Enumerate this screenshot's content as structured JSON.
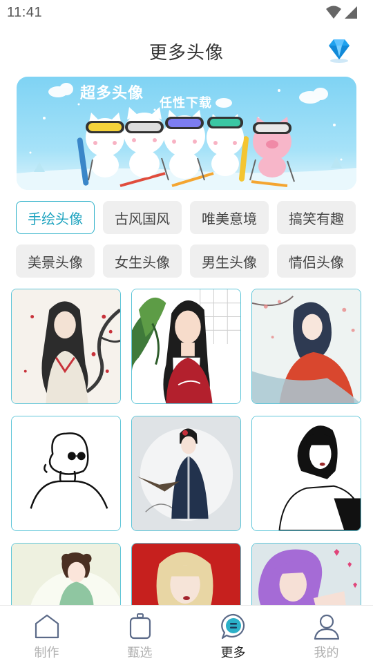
{
  "status_bar": {
    "time": "11:41"
  },
  "header": {
    "title": "更多头像"
  },
  "banner": {
    "title": "超多头像",
    "subtitle": "任性下载"
  },
  "categories": [
    {
      "label": "手绘头像",
      "active": true
    },
    {
      "label": "古风国风",
      "active": false
    },
    {
      "label": "唯美意境",
      "active": false
    },
    {
      "label": "搞笑有趣",
      "active": false
    },
    {
      "label": "美景头像",
      "active": false
    },
    {
      "label": "女生头像",
      "active": false
    },
    {
      "label": "男生头像",
      "active": false
    },
    {
      "label": "情侣头像",
      "active": false
    }
  ],
  "bottom_nav": [
    {
      "label": "制作",
      "icon": "pentagon-icon",
      "active": false
    },
    {
      "label": "甄选",
      "icon": "bag-icon",
      "active": false
    },
    {
      "label": "更多",
      "icon": "chat-bubble-icon",
      "active": true
    },
    {
      "label": "我的",
      "icon": "person-icon",
      "active": false
    }
  ],
  "colors": {
    "accent": "#2bb0c8",
    "chip_bg": "#efefef",
    "card_border": "#5ec5d8",
    "nav_inactive": "#b0b0b0"
  }
}
